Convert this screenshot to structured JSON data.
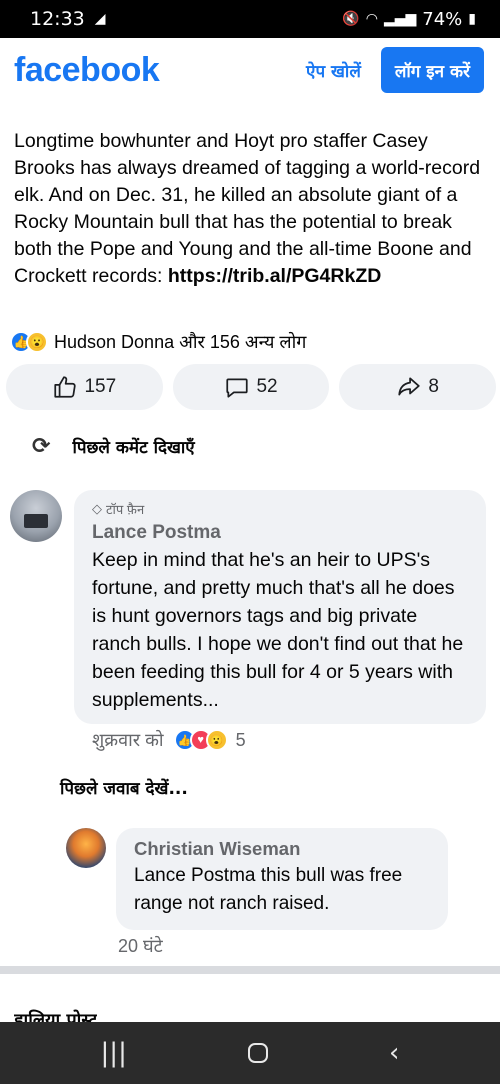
{
  "status_bar": {
    "time": "12:33",
    "battery": "74%"
  },
  "header": {
    "logo": "facebook",
    "open_app": "ऐप खोलें",
    "login": "लॉग इन करें"
  },
  "post": {
    "text": "Longtime bowhunter and Hoyt pro staffer Casey Brooks has always dreamed of tagging a world-record elk. And on Dec. 31, he killed an absolute giant of a Rocky Mountain bull that has the potential to break both the Pope and Young and the all-time Boone and Crockett records: ",
    "link": "https://trib.al/PG4RkZD",
    "reactions_text": "Hudson Donna और 156 अन्य लोग",
    "like_count": "157",
    "comment_count": "52",
    "share_count": "8"
  },
  "comments_section": {
    "previous_comments": "पिछले कमेंट दिखाएँ",
    "previous_replies": "पिछले जवाब देखें..."
  },
  "comments": [
    {
      "badge": "टॉप फ़ैन",
      "author": "Lance Postma",
      "text": "Keep in mind that he's an heir to UPS's fortune, and pretty much that's all he does is hunt governors tags and big private ranch bulls. I hope we don't find out that he been feeding this bull for 4 or 5 years with supplements...",
      "time": "शुक्रवार को",
      "reaction_count": "5"
    },
    {
      "author": "Christian Wiseman",
      "text": "Lance Postma this bull was free range not ranch raised.",
      "time": "20 घंटे"
    }
  ],
  "recent_posts_heading": "हालिया पोस्ट",
  "colors": {
    "brand": "#1877f2",
    "bubble": "#f0f2f5",
    "secondary_text": "#65676b"
  },
  "icons": [
    "refresh-icon",
    "like-icon",
    "comment-icon",
    "share-icon",
    "diamond-icon"
  ]
}
